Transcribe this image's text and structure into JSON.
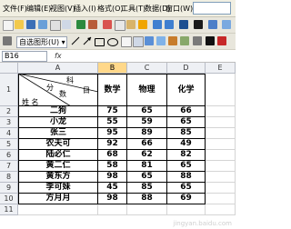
{
  "menu": [
    "文件(F)",
    "编辑(E)",
    "视图(V)",
    "插入(I)",
    "格式(O)",
    "工具(T)",
    "数据(D)",
    "窗口(W)"
  ],
  "toolbar": {
    "autoshape_label": "自选图形(U) ▾"
  },
  "formula_bar": {
    "name_box": "B16",
    "fx": "fx"
  },
  "columns": [
    "A",
    "B",
    "C",
    "D",
    "E"
  ],
  "rows": [
    "1",
    "2",
    "3",
    "4",
    "5",
    "6",
    "7",
    "8",
    "9",
    "10",
    "11"
  ],
  "header_cell": {
    "top_right": "科",
    "top_mid": "目",
    "mid": "分",
    "mid2": "数",
    "bottom_left": "姓  名"
  },
  "table": {
    "headers": [
      "数学",
      "物理",
      "化学"
    ],
    "rows": [
      [
        "二狗",
        "75",
        "65",
        "66"
      ],
      [
        "小龙",
        "55",
        "59",
        "65"
      ],
      [
        "张三",
        "95",
        "89",
        "85"
      ],
      [
        "农夫可",
        "92",
        "66",
        "49"
      ],
      [
        "陆必仁",
        "68",
        "62",
        "82"
      ],
      [
        "黄二仁",
        "58",
        "81",
        "65"
      ],
      [
        "黄东方",
        "98",
        "65",
        "88"
      ],
      [
        "李可妹",
        "45",
        "85",
        "65"
      ],
      [
        "方月月",
        "98",
        "88",
        "69"
      ]
    ]
  },
  "colors": {
    "selected_header": "#ffd88a"
  },
  "watermark": "jingyan.baidu.com"
}
